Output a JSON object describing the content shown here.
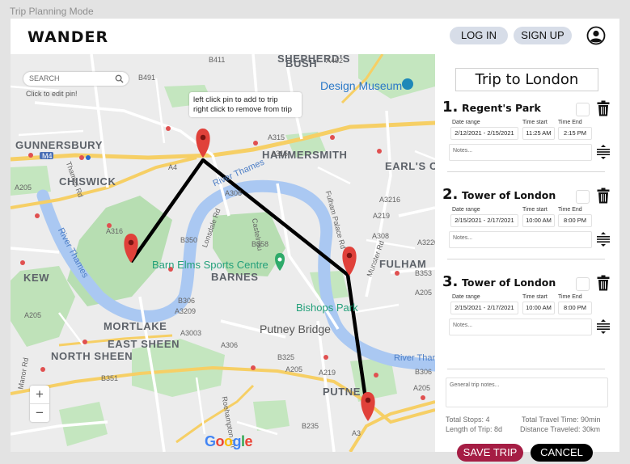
{
  "mode_label": "Trip Planning Mode",
  "header": {
    "logo": "WANDER",
    "login": "LOG IN",
    "signup": "SIGN UP"
  },
  "map": {
    "search_placeholder": "SEARCH",
    "edit_hint": "Click to edit pin!",
    "tooltip_line1": "left click pin to add to trip",
    "tooltip_line2": "right click to remove from trip",
    "zoom_in": "+",
    "zoom_out": "−",
    "google": [
      "G",
      "o",
      "o",
      "g",
      "l",
      "e"
    ],
    "google_colors": [
      "#4285f4",
      "#ea4335",
      "#fbbc05",
      "#4285f4",
      "#34a853",
      "#ea4335"
    ],
    "labels": {
      "shepherds_bush": "SHEPHERD'S",
      "bush": "BUSH",
      "design_museum": "Design Museum",
      "gunnersbury": "GUNNERSBURY",
      "hammersmith": "HAMMERSMITH",
      "earls_c": "EARL'S C",
      "chiswick": "CHISWICK",
      "river_thames_1": "River Thames",
      "river_thames_2": "River Thames",
      "river_thames_3": "River Tham",
      "kew": "KEW",
      "fulham": "FULHAM",
      "barn_elms": "Barn Elms Sports Centre",
      "barnes": "BARNES",
      "bishops_park": "Bishops Park",
      "mortlake": "MORTLAKE",
      "putney_bridge": "Putney Bridge",
      "east_sheen": "EAST SHEEN",
      "north_sheen": "NORTH SHEEN",
      "putney": "PUTNE",
      "a205": "A205",
      "a3": "A3",
      "m4": "M4",
      "a315": "A315",
      "a4": "A4",
      "a306": "A306",
      "a3216": "A3216",
      "a219": "A219",
      "a308": "A308",
      "b491": "B491",
      "a315b": "A315",
      "b411": "B411",
      "a402": "A402",
      "a205b": "A205",
      "a3220": "A3220",
      "b306": "B306",
      "a3209": "A3209",
      "b351": "B351",
      "a316": "A316",
      "a205c": "A205",
      "a219b": "A219",
      "b353": "B353",
      "a205d": "A205",
      "b306b": "B306",
      "a205e": "A205",
      "b350": "B350",
      "b358": "B358",
      "a3003": "A3003",
      "a306b": "A306",
      "b325": "B325",
      "b235": "B235"
    },
    "street_labels": {
      "lonsdale": "Lonsdale Rd",
      "castelnau": "Castelnau",
      "fulham_palace": "Fulham Palace Rd",
      "munster": "Munster Rd",
      "roehampton": "Roehampton Ln",
      "manor": "Manor Rd",
      "thames": "Thames Rd"
    }
  },
  "trip": {
    "title": "Trip to London",
    "labels": {
      "date_range": "Date range",
      "time_start": "Time start",
      "time_end": "Time End",
      "notes": "Notes..."
    },
    "stops": [
      {
        "num": "1.",
        "name": "Regent's Park",
        "date_range": "2/12/2021 - 2/15/2021",
        "time_start": "11:25 AM",
        "time_end": "2:15 PM"
      },
      {
        "num": "2.",
        "name": "Tower of London",
        "date_range": "2/15/2021 - 2/17/2021",
        "time_start": "10:00 AM",
        "time_end": "8:00 PM"
      },
      {
        "num": "3.",
        "name": "Tower of London",
        "date_range": "2/15/2021 - 2/17/2021",
        "time_start": "10:00 AM",
        "time_end": "8:00 PM"
      }
    ],
    "general_notes_placeholder": "General trip notes...",
    "stats": {
      "total_stops": "Total Stops: 4",
      "length": "Length of Trip: 8d",
      "travel_time": "Total Travel Time: 90min",
      "distance": "Distance Traveled: 30km"
    },
    "save": "SAVE TRIP",
    "cancel": "CANCEL"
  },
  "colors": {
    "save_button": "#a51d44",
    "pin": "#e0413a",
    "river": "#aac8f2",
    "park": "#b7deb2",
    "route": "#000000"
  }
}
